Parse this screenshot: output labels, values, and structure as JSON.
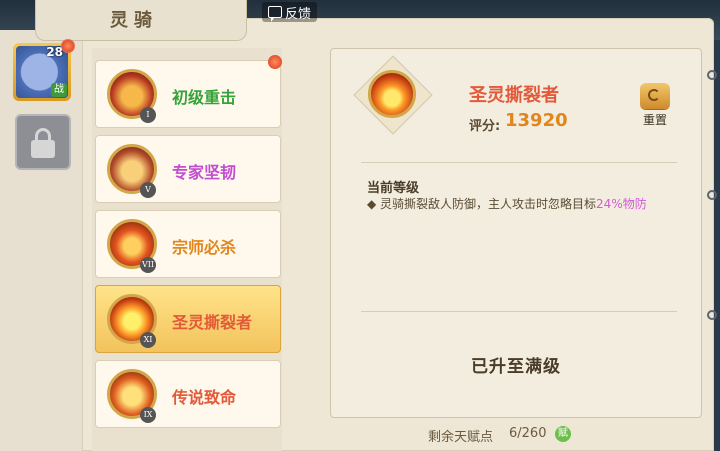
{
  "header": {
    "title": "灵骑",
    "feedback": "反馈"
  },
  "sidebar": {
    "mount": {
      "level": "28",
      "badge": "战"
    },
    "locked_slot": "lock-icon"
  },
  "skills": [
    {
      "name": "初级重击",
      "rank": "I",
      "name_color": "#36a23a",
      "has_alert": true
    },
    {
      "name": "专家坚韧",
      "rank": "V",
      "name_color": "#c24dd0",
      "has_alert": false
    },
    {
      "name": "宗师必杀",
      "rank": "VII",
      "name_color": "#e0861c",
      "has_alert": false
    },
    {
      "name": "圣灵撕裂者",
      "rank": "XI",
      "name_color": "#e35a3a",
      "has_alert": false,
      "selected": true
    },
    {
      "name": "传说致命",
      "rank": "IX",
      "name_color": "#e35a3a",
      "has_alert": false
    }
  ],
  "detail": {
    "name": "圣灵撕裂者",
    "score_label": "评分:",
    "score": "13920",
    "reset_label": "重置",
    "current_level_title": "当前等级",
    "description_prefix": "◆ 灵骑撕裂敌人防御，主人攻击时忽略目标",
    "description_highlight": "24%物防",
    "status": "已升至满级"
  },
  "footer": {
    "talent_label": "剩余天赋点",
    "talent_count": "6/260",
    "talent_badge": "赋"
  }
}
